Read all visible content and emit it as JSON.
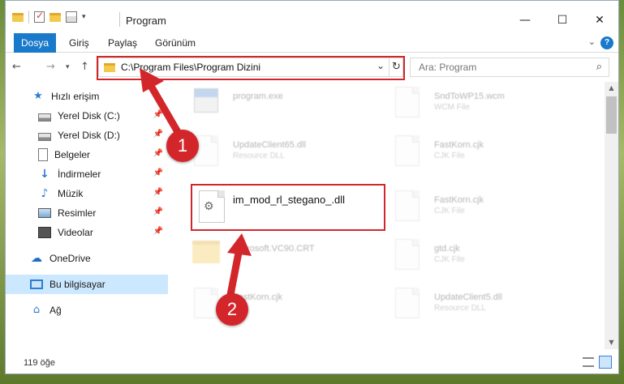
{
  "window": {
    "title": "Program",
    "controls": {
      "minimize": "—",
      "maximize": "☐",
      "close": "✕"
    }
  },
  "ribbon": {
    "tabs": [
      "Dosya",
      "Giriş",
      "Paylaş",
      "Görünüm"
    ],
    "help": "?"
  },
  "nav": {
    "back": "←",
    "forward": "→",
    "recent": "▾",
    "up": "↑",
    "address": "C:\\Program Files\\Program Dizini",
    "refresh": "↻",
    "search_placeholder": "Ara: Program"
  },
  "sidebar": {
    "items": [
      {
        "label": "Hızlı erişim",
        "icon": "star-icon",
        "pinned": false
      },
      {
        "label": "Yerel Disk (C:)",
        "icon": "drive-icon",
        "pinned": true
      },
      {
        "label": "Yerel Disk (D:)",
        "icon": "drive-icon",
        "pinned": true
      },
      {
        "label": "Belgeler",
        "icon": "document-icon",
        "pinned": true
      },
      {
        "label": "İndirmeler",
        "icon": "download-icon",
        "pinned": true
      },
      {
        "label": "Müzik",
        "icon": "music-icon",
        "pinned": true
      },
      {
        "label": "Resimler",
        "icon": "pictures-icon",
        "pinned": true
      },
      {
        "label": "Videolar",
        "icon": "video-icon",
        "pinned": true
      },
      {
        "label": "OneDrive",
        "icon": "cloud-icon",
        "pinned": false
      },
      {
        "label": "Bu bilgisayar",
        "icon": "computer-icon",
        "pinned": false,
        "selected": true
      },
      {
        "label": "Ağ",
        "icon": "network-icon",
        "pinned": false
      }
    ]
  },
  "files": [
    {
      "name": "program.exe",
      "type": "",
      "icon": "exe-icon"
    },
    {
      "name": "SndToWP15.wcm",
      "type": "WCM File",
      "icon": "file-icon"
    },
    {
      "name": "UpdateClient65.dll",
      "type": "Resource DLL",
      "icon": "file-icon"
    },
    {
      "name": "FastKorn.cjk",
      "type": "CJK File",
      "icon": "file-icon"
    },
    {
      "name": "im_mod_rl_stegano_.dll",
      "type": "",
      "icon": "gear-file-icon",
      "target": true
    },
    {
      "name": "FastKorn.cjk",
      "type": "CJK File",
      "icon": "file-icon"
    },
    {
      "name": "Microsoft.VC90.CRT",
      "type": "",
      "icon": "folder-icon"
    },
    {
      "name": "gtd.cjk",
      "type": "CJK File",
      "icon": "file-icon"
    },
    {
      "name": "FastKorn.cjk",
      "type": "File",
      "icon": "file-icon"
    },
    {
      "name": "UpdateClient5.dll",
      "type": "Resource DLL",
      "icon": "file-icon"
    }
  ],
  "status": {
    "count": "119 öğe"
  },
  "annotations": {
    "step1": "1",
    "step2": "2",
    "highlight_color": "#d3262b"
  }
}
